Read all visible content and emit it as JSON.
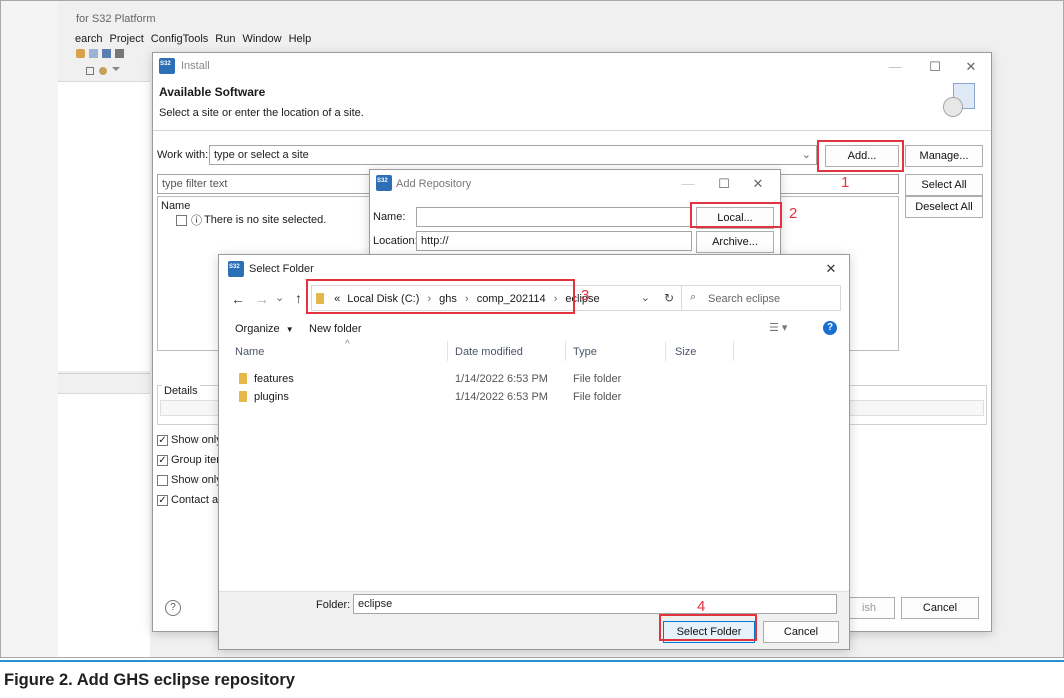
{
  "ide": {
    "title": "for S32 Platform",
    "menu": [
      "earch",
      "Project",
      "ConfigTools",
      "Run",
      "Window",
      "Help"
    ]
  },
  "install": {
    "title": "Install",
    "heading": "Available Software",
    "subheading": "Select a site or enter the location of a site.",
    "work_with_label": "Work with:",
    "work_with_value": "type or select a site",
    "add_label": "Add...",
    "manage_label": "Manage...",
    "filter_placeholder": "type filter text",
    "select_all_label": "Select All",
    "deselect_all_label": "Deselect All",
    "tree_header": "Name",
    "tree_empty": "There is no site selected.",
    "details_label": "Details",
    "options": [
      {
        "label": "Show only t",
        "checked": true
      },
      {
        "label": "Group items",
        "checked": true
      },
      {
        "label": "Show only s",
        "checked": false
      },
      {
        "label": "Contact all u",
        "checked": true
      }
    ],
    "finish_label": "ish",
    "cancel_label": "Cancel"
  },
  "add_repo": {
    "title": "Add Repository",
    "name_label": "Name:",
    "name_value": "",
    "location_label": "Location:",
    "location_value": "http://",
    "local_label": "Local...",
    "archive_label": "Archive..."
  },
  "select_folder": {
    "title": "Select Folder",
    "breadcrumb": [
      "«",
      "Local Disk (C:)",
      "ghs",
      "comp_202114",
      "eclipse"
    ],
    "search_placeholder": "Search eclipse",
    "organize_label": "Organize",
    "new_folder_label": "New folder",
    "columns": [
      "Name",
      "Date modified",
      "Type",
      "Size"
    ],
    "rows": [
      {
        "name": "features",
        "date": "1/14/2022 6:53 PM",
        "type": "File folder"
      },
      {
        "name": "plugins",
        "date": "1/14/2022 6:53 PM",
        "type": "File folder"
      }
    ],
    "folder_label": "Folder:",
    "folder_value": "eclipse",
    "select_label": "Select Folder",
    "cancel_label": "Cancel"
  },
  "annotations": [
    "1",
    "2",
    "3",
    "4"
  ],
  "caption": "Figure 2.  Add GHS eclipse repository",
  "colors": {
    "annotation": "#e2343f",
    "caption_rule": "#2b8fd6",
    "link": "#1a5fb4"
  }
}
